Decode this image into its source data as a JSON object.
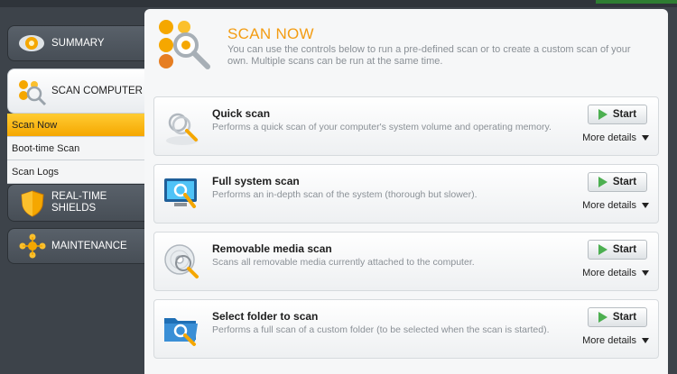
{
  "colors": {
    "accent": "#f39c12",
    "sidebar_bg": "#3d434a",
    "active_subnav": "#f5a700",
    "start_play": "#4caf50"
  },
  "sidebar": {
    "items": [
      {
        "label": "SUMMARY",
        "icon": "summary-eye-icon"
      },
      {
        "label": "SCAN COMPUTER",
        "icon": "scan-computer-icon"
      },
      {
        "label": "REAL-TIME SHIELDS",
        "icon": "shield-icon"
      },
      {
        "label": "MAINTENANCE",
        "icon": "maintenance-icon"
      }
    ],
    "subitems": [
      {
        "label": "Scan Now",
        "active": true
      },
      {
        "label": "Boot-time Scan",
        "active": false
      },
      {
        "label": "Scan Logs",
        "active": false
      }
    ]
  },
  "header": {
    "title": "SCAN NOW",
    "description": "You can use the controls below to run a pre-defined scan or to create a custom scan of your own. Multiple scans can be run at the same time."
  },
  "scans": [
    {
      "title": "Quick scan",
      "description": "Performs a quick scan of your computer's system volume and operating memory.",
      "start_label": "Start",
      "more_label": "More details",
      "icon": "quick-scan-icon"
    },
    {
      "title": "Full system scan",
      "description": "Performs an in-depth scan of the system (thorough but slower).",
      "start_label": "Start",
      "more_label": "More details",
      "icon": "full-scan-monitor-icon"
    },
    {
      "title": "Removable media scan",
      "description": "Scans all removable media currently attached to the computer.",
      "start_label": "Start",
      "more_label": "More details",
      "icon": "removable-media-disc-icon"
    },
    {
      "title": "Select folder to scan",
      "description": "Performs a full scan of a custom folder (to be selected when the scan is started).",
      "start_label": "Start",
      "more_label": "More details",
      "icon": "folder-scan-icon"
    }
  ]
}
